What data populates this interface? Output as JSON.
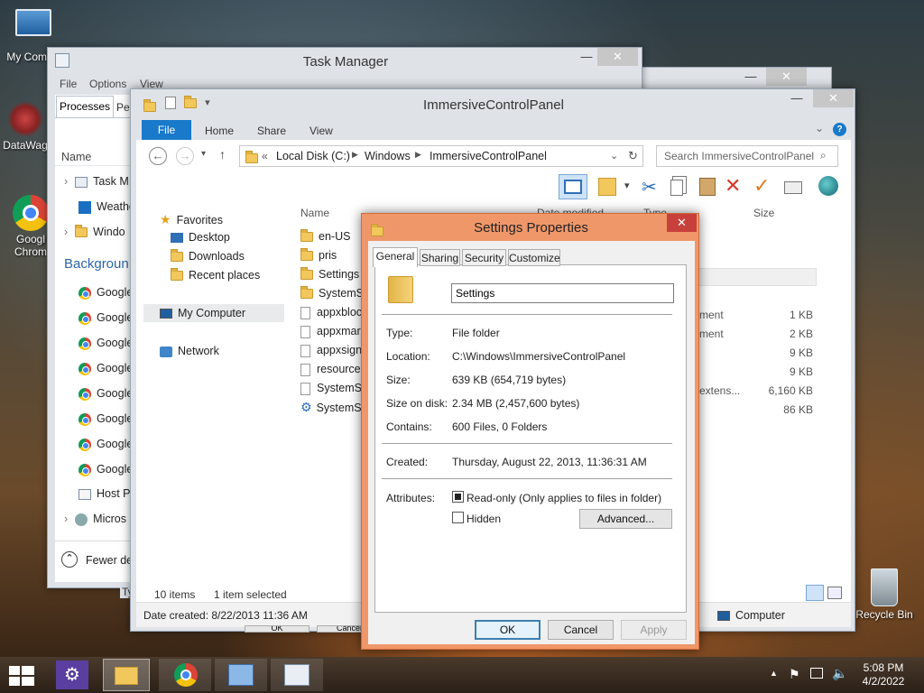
{
  "desktop": {
    "icons": [
      {
        "label": "My Comp"
      },
      {
        "label": "DataWag"
      },
      {
        "label": "Googl Chrom"
      },
      {
        "label": "Recycle Bin"
      }
    ]
  },
  "task_manager": {
    "title": "Task Manager",
    "menu": [
      "File",
      "Options",
      "View"
    ],
    "tabs": [
      "Processes",
      "Per"
    ],
    "col_name": "Name",
    "rows": [
      {
        "label": "Task M",
        "icon": "task-manager-icon"
      },
      {
        "label": "Weathe",
        "icon": "weather-icon"
      },
      {
        "label": "Windo",
        "icon": "folder-icon"
      }
    ],
    "background_label": "Backgroun",
    "bg_rows": [
      "Google",
      "Google",
      "Google",
      "Google",
      "Google",
      "Google",
      "Google",
      "Google"
    ],
    "other_rows": [
      "Host Pr",
      "Micros"
    ],
    "fewer_details": "Fewer deta",
    "bottom_cut": "Ty"
  },
  "explorer": {
    "title": "ImmersiveControlPanel",
    "ribbon_tabs": {
      "file": "File",
      "home": "Home",
      "share": "Share",
      "view": "View"
    },
    "address": {
      "prefix": "«",
      "parts": [
        "Local Disk (C:)",
        "Windows",
        "ImmersiveControlPanel"
      ]
    },
    "search_placeholder": "Search ImmersiveControlPanel",
    "nav": {
      "favorites": "Favorites",
      "desktop": "Desktop",
      "downloads": "Downloads",
      "recent": "Recent places",
      "computer": "My Computer",
      "network": "Network"
    },
    "columns": {
      "name": "Name",
      "date": "Date modified",
      "type": "Type",
      "size": "Size"
    },
    "files": [
      {
        "name": "en-US",
        "kind": "folder"
      },
      {
        "name": "pris",
        "kind": "folder"
      },
      {
        "name": "Settings",
        "kind": "folder"
      },
      {
        "name": "SystemS",
        "kind": "folder"
      },
      {
        "name": "appxbloc",
        "kind": "file"
      },
      {
        "name": "appxmar",
        "kind": "file"
      },
      {
        "name": "appxsign",
        "kind": "file"
      },
      {
        "name": "resource",
        "kind": "file"
      },
      {
        "name": "SystemS",
        "kind": "file"
      },
      {
        "name": "SystemS",
        "kind": "gear"
      }
    ],
    "type_cells": [
      "ment",
      "ment",
      "extens..."
    ],
    "size_cells": [
      "1 KB",
      "2 KB",
      "9 KB",
      "9 KB",
      "6,160 KB",
      "86 KB"
    ],
    "status": {
      "items": "10 items",
      "selected": "1 item selected"
    },
    "details_bar": {
      "date_created": "Date created: 8/22/2013 11:36 AM",
      "computer": "Computer"
    },
    "behind_buttons": [
      "OK",
      "Cancel"
    ]
  },
  "properties": {
    "title": "Settings Properties",
    "tabs": [
      "General",
      "Sharing",
      "Security",
      "Customize"
    ],
    "name_value": "Settings",
    "type_label": "Type:",
    "type_value": "File folder",
    "location_label": "Location:",
    "location_value": "C:\\Windows\\ImmersiveControlPanel",
    "size_label": "Size:",
    "size_value": "639 KB (654,719 bytes)",
    "sod_label": "Size on disk:",
    "sod_value": "2.34 MB (2,457,600 bytes)",
    "contains_label": "Contains:",
    "contains_value": "600 Files, 0 Folders",
    "created_label": "Created:",
    "created_value": "Thursday, August 22, 2013, 11:36:31 AM",
    "attributes_label": "Attributes:",
    "readonly_label": "Read-only (Only applies to files in folder)",
    "hidden_label": "Hidden",
    "advanced_label": "Advanced...",
    "ok_label": "OK",
    "cancel_label": "Cancel",
    "apply_label": "Apply"
  },
  "taskbar": {
    "time": "5:08 PM",
    "date": "4/2/2022"
  },
  "colors": {
    "accent": "#1979ca",
    "dialog_border": "#f0976a",
    "close_red": "#c7403a"
  }
}
